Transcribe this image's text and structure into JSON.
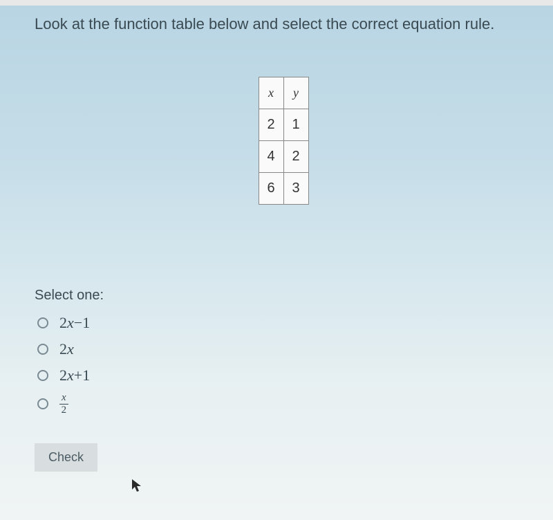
{
  "question": {
    "text": "Look at the function table below and select the correct equation rule."
  },
  "table": {
    "header_x": "x",
    "header_y": "y",
    "rows": [
      {
        "x": "2",
        "y": "1"
      },
      {
        "x": "4",
        "y": "2"
      },
      {
        "x": "6",
        "y": "3"
      }
    ]
  },
  "select_label": "Select one:",
  "options": {
    "opt1_coef": "2",
    "opt1_var": "x",
    "opt1_op": " − ",
    "opt1_const": "1",
    "opt2_coef": "2",
    "opt2_var": "x",
    "opt3_coef": "2",
    "opt3_var": "x",
    "opt3_op": " + ",
    "opt3_const": "1",
    "opt4_num": "x",
    "opt4_den": "2"
  },
  "check_button": "Check"
}
